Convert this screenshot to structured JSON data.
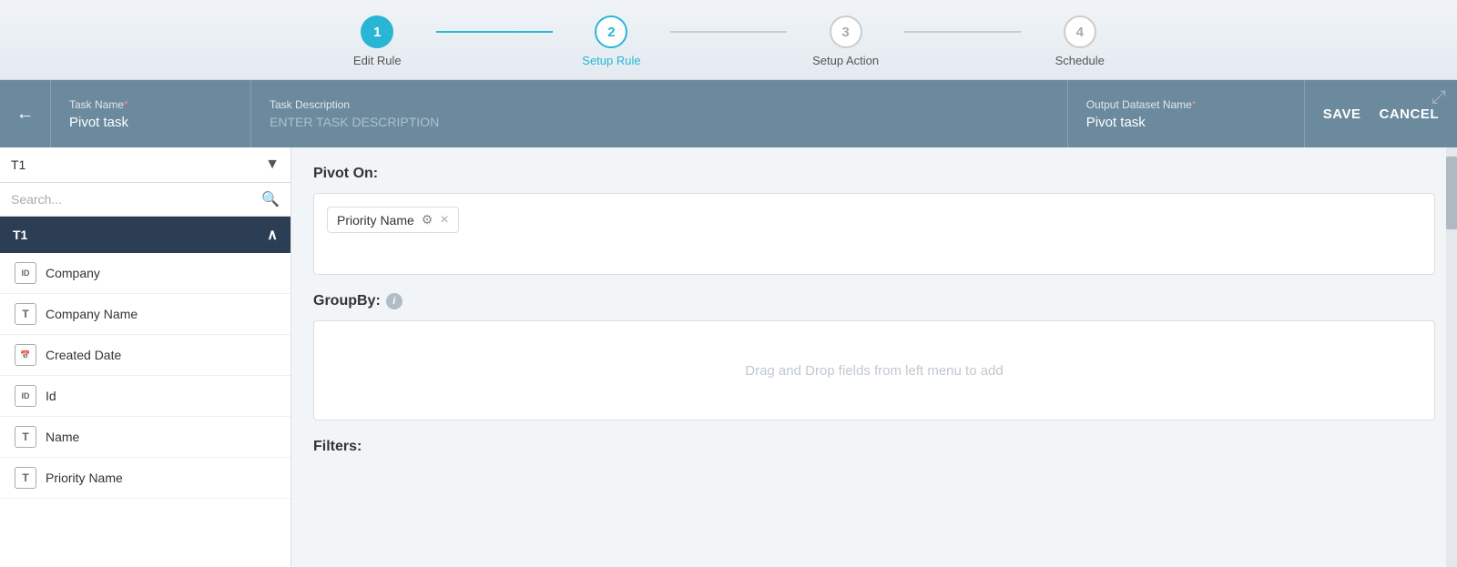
{
  "wizard": {
    "steps": [
      {
        "id": "step-1",
        "number": "1",
        "label": "Edit Rule",
        "state": "done"
      },
      {
        "id": "step-2",
        "number": "2",
        "label": "Setup Rule",
        "state": "active"
      },
      {
        "id": "step-3",
        "number": "3",
        "label": "Setup Action",
        "state": "inactive"
      },
      {
        "id": "step-4",
        "number": "4",
        "label": "Schedule",
        "state": "inactive"
      }
    ]
  },
  "header": {
    "back_label": "←",
    "task_name_label": "Task Name",
    "task_name_required": "*",
    "task_name_value": "Pivot task",
    "task_desc_label": "Task Description",
    "task_desc_placeholder": "ENTER TASK DESCRIPTION",
    "output_name_label": "Output Dataset Name",
    "output_name_required": "*",
    "output_name_value": "Pivot task",
    "save_label": "SAVE",
    "cancel_label": "CANCEL"
  },
  "sidebar": {
    "dropdown_value": "T1",
    "search_placeholder": "Search...",
    "group_label": "T1",
    "fields": [
      {
        "name": "Company",
        "icon_type": "id",
        "icon_label": "ID"
      },
      {
        "name": "Company Name",
        "icon_type": "text",
        "icon_label": "T"
      },
      {
        "name": "Created Date",
        "icon_type": "date",
        "icon_label": "📅"
      },
      {
        "name": "Id",
        "icon_type": "id",
        "icon_label": "ID"
      },
      {
        "name": "Name",
        "icon_type": "text",
        "icon_label": "T"
      },
      {
        "name": "Priority Name",
        "icon_type": "text",
        "icon_label": "T"
      }
    ]
  },
  "main": {
    "pivot_section_title": "Pivot On:",
    "pivot_tag": "Priority Name",
    "pivot_tag_gear": "⚙",
    "pivot_tag_remove": "×",
    "groupby_section_title": "GroupBy:",
    "groupby_drop_text": "Drag and Drop fields from left menu to add",
    "filters_section_title": "Filters:"
  }
}
